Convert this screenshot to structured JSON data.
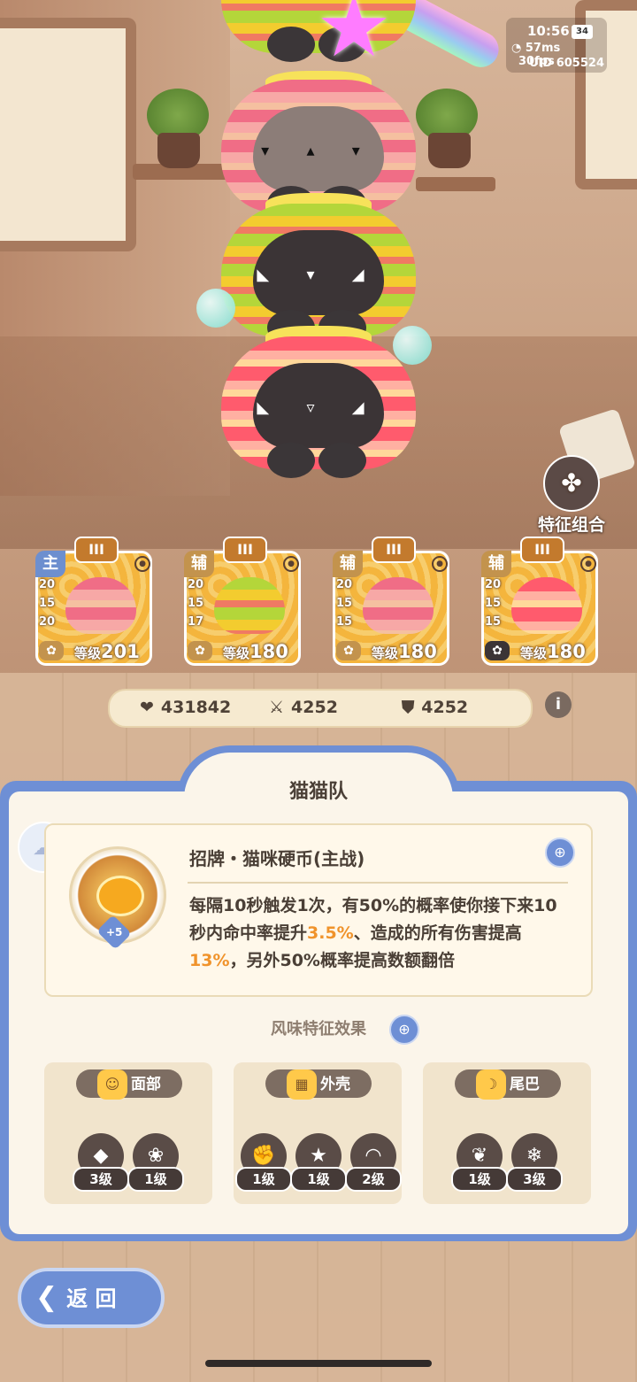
{
  "hud": {
    "time": "10:56",
    "battery": "34",
    "ping": "57ms",
    "fps": "30fps",
    "uid_label": "UID",
    "uid": "605524"
  },
  "trait_combo": {
    "label": "特征组合"
  },
  "cards": [
    {
      "role": "主",
      "rank": "III",
      "stats": [
        "20",
        "15",
        "20"
      ],
      "level_label": "等级",
      "level": "201"
    },
    {
      "role": "辅",
      "rank": "III",
      "stats": [
        "20",
        "15",
        "17"
      ],
      "level_label": "等级",
      "level": "180"
    },
    {
      "role": "辅",
      "rank": "III",
      "stats": [
        "20",
        "15",
        "15"
      ],
      "level_label": "等级",
      "level": "180"
    },
    {
      "role": "辅",
      "rank": "III",
      "stats": [
        "20",
        "15",
        "15"
      ],
      "level_label": "等级",
      "level": "180"
    }
  ],
  "team_stats": {
    "hp": "431842",
    "attack": "4252",
    "defense": "4252",
    "info": "i"
  },
  "panel": {
    "title": "猫猫队",
    "skill": {
      "name": "招牌・猫咪硬币(主战)",
      "bonus": "+5",
      "desc_a": "每隔10秒触发1次，有50%的概率使你接下来10秒内命中率提升",
      "desc_b": "3.5%",
      "desc_c": "、造成的所有伤害提高",
      "desc_d": "13%",
      "desc_e": "，另外50%概率提高数额翻倍"
    },
    "flavor_title": "风味特征效果",
    "traits": [
      {
        "name": "面部",
        "levels": [
          "3级",
          "1级"
        ]
      },
      {
        "name": "外壳",
        "levels": [
          "1级",
          "1级",
          "2级"
        ]
      },
      {
        "name": "尾巴",
        "levels": [
          "1级",
          "3级"
        ]
      }
    ]
  },
  "back": {
    "label": "返 回"
  },
  "colors": {
    "accent": "#6e8fd5",
    "highlight": "#f0932b",
    "panel_bg": "#fbf5ea"
  }
}
